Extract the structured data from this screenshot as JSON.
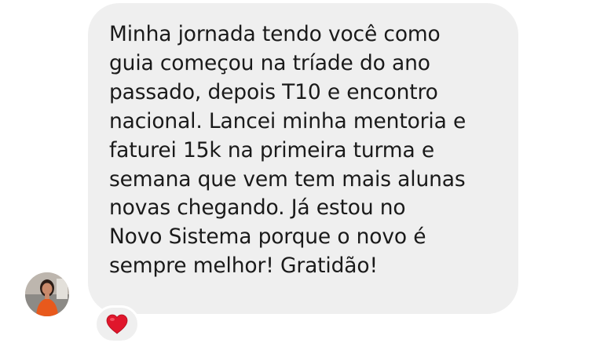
{
  "message": {
    "lines": [
      "Minha jornada tendo você como",
      "guia começou na tríade do ano",
      "passado, depois T10 e encontro",
      "nacional. Lancei minha mentoria e",
      "faturei 15k na primeira turma e",
      "semana que vem tem mais alunas",
      "novas chegando. Já estou no",
      "Novo Sistema porque o novo é",
      "sempre melhor! Gratidão!"
    ]
  },
  "reaction": {
    "icon": "heart-icon",
    "color": "#e0162b"
  },
  "avatar": {
    "icon": "profile-photo"
  },
  "colors": {
    "bubble": "#efefef",
    "text": "#1a1a1a",
    "background": "#ffffff"
  }
}
